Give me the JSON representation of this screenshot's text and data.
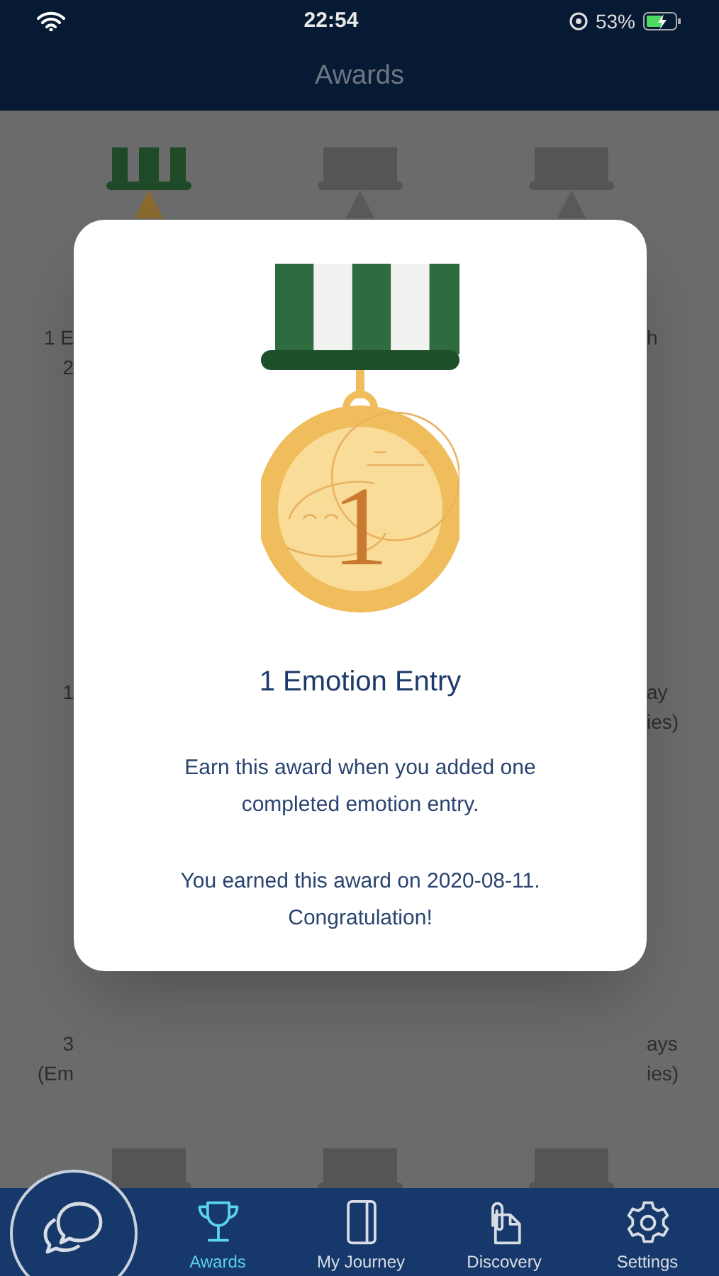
{
  "status_bar": {
    "time": "22:54",
    "battery": "53%"
  },
  "header": {
    "title": "Awards"
  },
  "background_top_medals": [
    {
      "earned": true
    },
    {
      "earned": false
    },
    {
      "earned": false
    }
  ],
  "background_rows": [
    {
      "left_text": [
        "1 E",
        "2"
      ],
      "right_text": [
        "h"
      ]
    },
    {
      "left_text": [
        "1"
      ],
      "right_text": [
        "ay",
        "ies)"
      ]
    },
    {
      "left_text": [
        "3",
        "(Em"
      ],
      "right_text": [
        "ays",
        "ies)"
      ]
    }
  ],
  "background_bottom_medals": [
    {
      "earned": false
    },
    {
      "earned": false
    },
    {
      "earned": false
    }
  ],
  "dialog": {
    "medal_number": "1",
    "title": "1 Emotion Entry",
    "paragraphs": [
      "Earn this award when you added one completed emotion entry.",
      "You earned this award on 2020-08-11. Congratulation!"
    ]
  },
  "tab_bar": {
    "tabs": [
      {
        "kind": "trophy",
        "label": "Awards",
        "selected": true
      },
      {
        "kind": "book",
        "label": "My Journey",
        "selected": false
      },
      {
        "kind": "document",
        "label": "Discovery",
        "selected": false
      },
      {
        "kind": "gear",
        "label": "Settings",
        "selected": false
      }
    ]
  }
}
